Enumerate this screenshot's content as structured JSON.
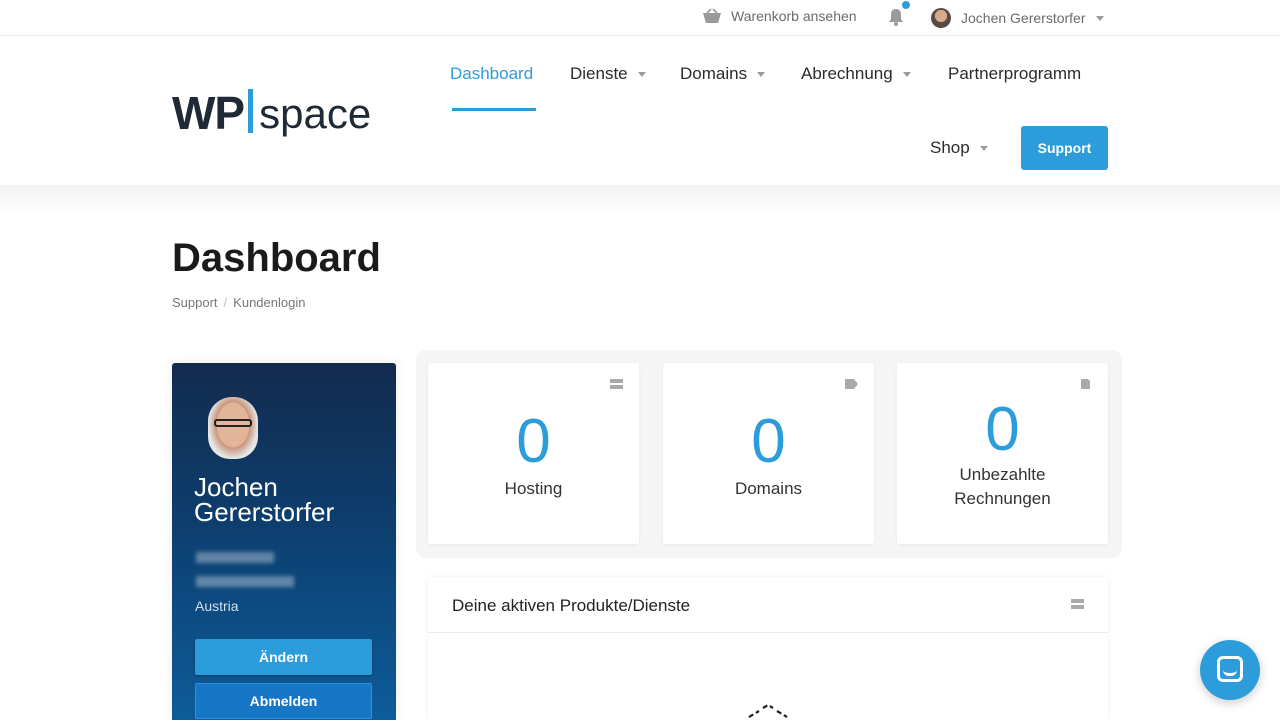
{
  "topbar": {
    "cart_label": "Warenkorb ansehen",
    "user_name": "Jochen Gererstorfer"
  },
  "brand": {
    "logo_left": "WP",
    "logo_right": "space"
  },
  "nav": {
    "items": [
      {
        "label": "Dashboard"
      },
      {
        "label": "Dienste"
      },
      {
        "label": "Domains"
      },
      {
        "label": "Abrechnung"
      },
      {
        "label": "Partnerprogramm"
      },
      {
        "label": "Shop"
      }
    ],
    "support_label": "Support"
  },
  "page": {
    "title": "Dashboard",
    "breadcrumb": [
      "Support",
      "Kundenlogin"
    ]
  },
  "profile": {
    "name": "Jochen Gererstorfer",
    "country": "Austria",
    "edit_label": "Ändern",
    "logout_label": "Abmelden"
  },
  "stats": [
    {
      "value": "0",
      "label": "Hosting",
      "icon": "server-icon"
    },
    {
      "value": "0",
      "label": "Domains",
      "icon": "tag-icon"
    },
    {
      "value": "0",
      "label": "Unbezahlte Rechnungen",
      "icon": "document-icon"
    }
  ],
  "products_panel": {
    "title": "Deine aktiven Produkte/Dienste"
  },
  "colors": {
    "accent": "#2d9cdb",
    "profile_top": "#132b4e",
    "profile_bottom": "#0d5c9a"
  }
}
